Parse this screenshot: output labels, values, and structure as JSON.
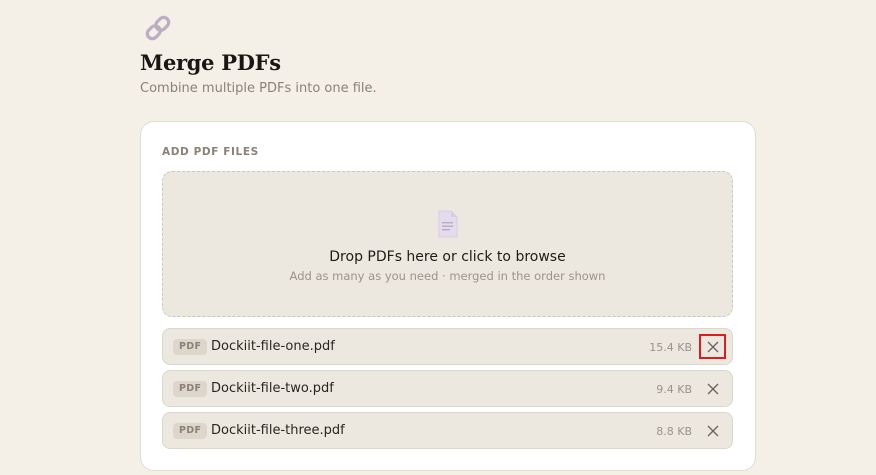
{
  "header": {
    "title": "Merge PDFs",
    "subtitle": "Combine multiple PDFs into one file.",
    "logo_icon": "link-chain-icon"
  },
  "upload": {
    "section_label": "ADD PDF FILES",
    "dropzone_icon": "document-icon",
    "dropzone_title": "Drop PDFs here or click to browse",
    "dropzone_subtitle": "Add as many as you need · merged in the order shown"
  },
  "files": [
    {
      "badge": "PDF",
      "name": "Dockiit-file-one.pdf",
      "size": "15.4 KB",
      "highlighted": true
    },
    {
      "badge": "PDF",
      "name": "Dockiit-file-two.pdf",
      "size": "9.4 KB",
      "highlighted": false
    },
    {
      "badge": "PDF",
      "name": "Dockiit-file-three.pdf",
      "size": "8.8 KB",
      "highlighted": false
    }
  ],
  "colors": {
    "background": "#f4efe7",
    "card": "#ffffff",
    "row": "#ede8df",
    "highlight": "#e01b1b"
  }
}
